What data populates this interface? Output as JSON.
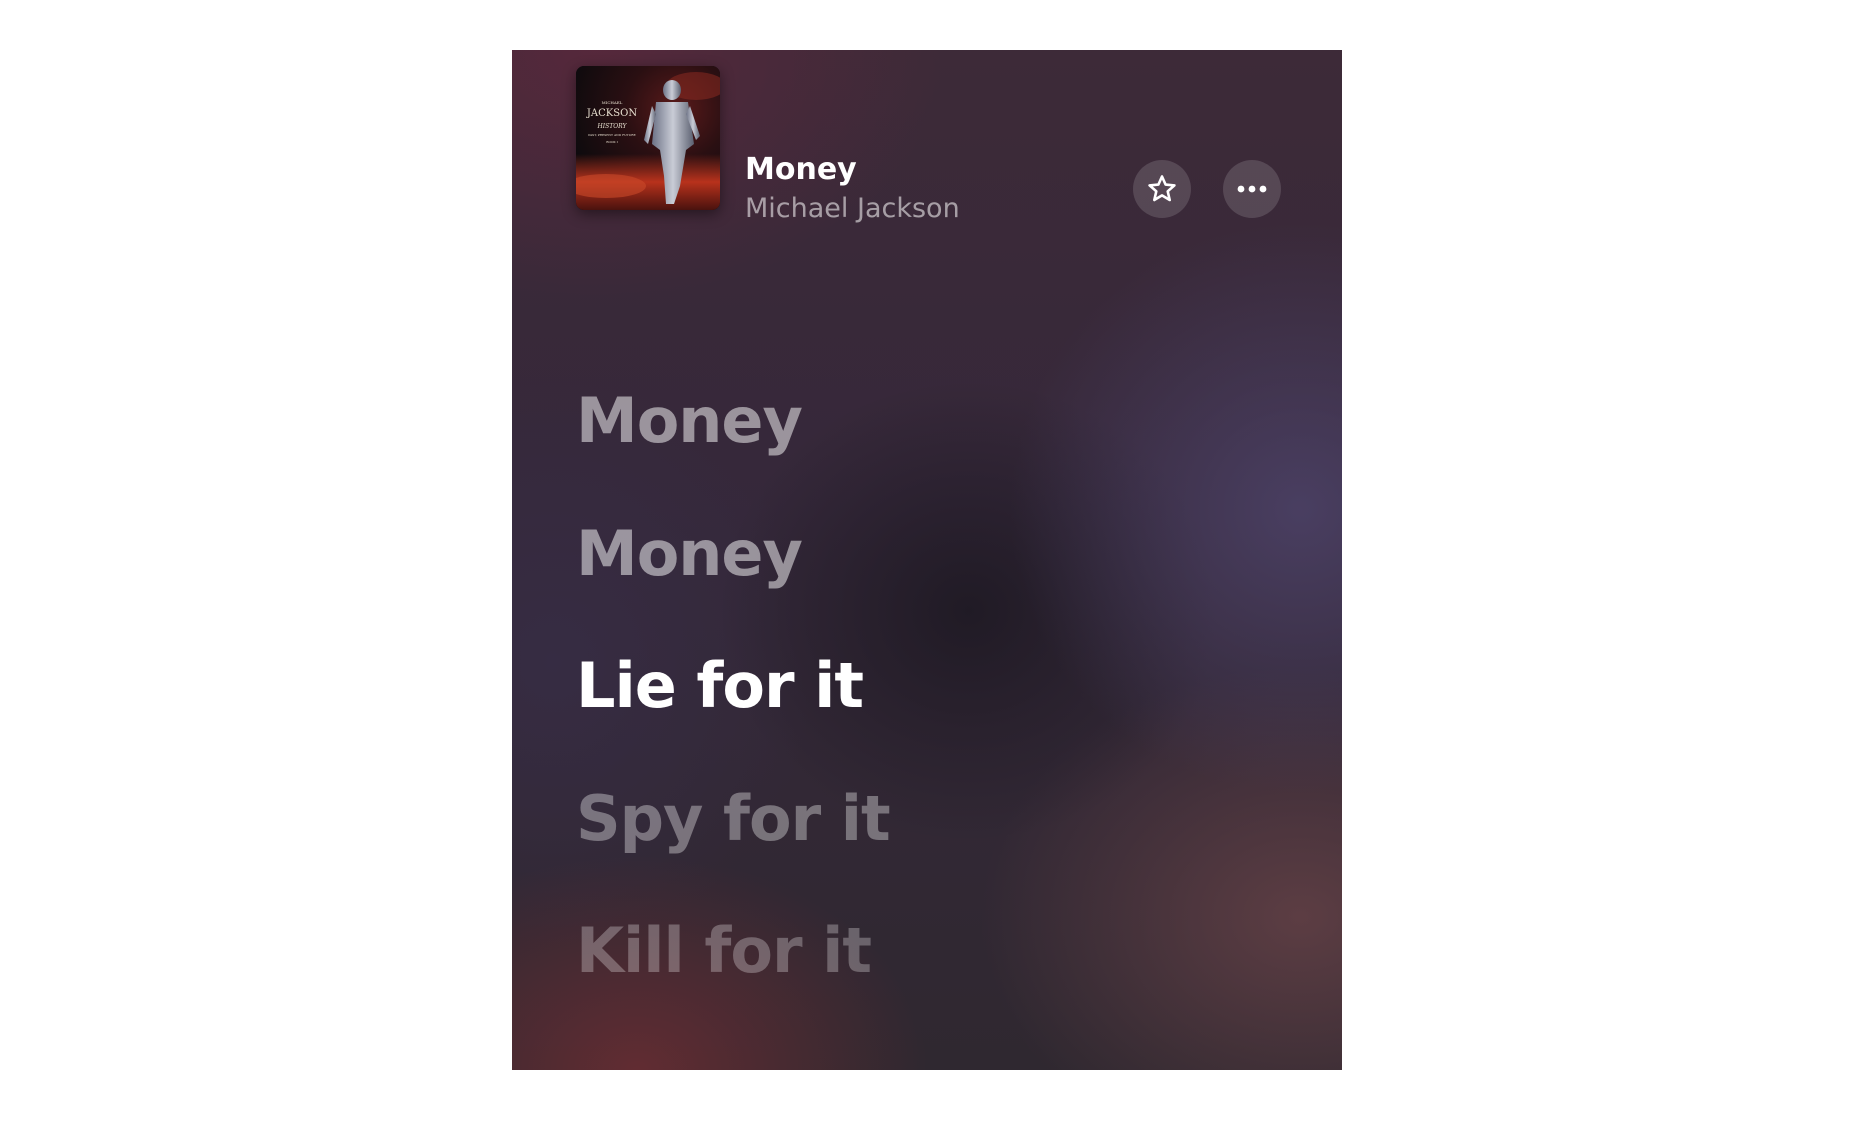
{
  "now_playing": {
    "title": "Money",
    "artist": "Michael Jackson",
    "album_art": {
      "icon": "album-cover-image",
      "text_lines": [
        "MICHAEL",
        "JACKSON",
        "HISTORY",
        "PAST, PRESENT AND FUTURE",
        "BOOK I"
      ]
    }
  },
  "actions": {
    "favorite_icon": "star-outline-icon",
    "more_icon": "ellipsis-icon"
  },
  "lyrics": {
    "lines": [
      {
        "text": "Money",
        "state": "past"
      },
      {
        "text": "Money",
        "state": "past"
      },
      {
        "text": "Lie for it",
        "state": "current"
      },
      {
        "text": "Spy for it",
        "state": "next"
      },
      {
        "text": "Kill for it",
        "state": "next"
      }
    ]
  },
  "colors": {
    "background": "#3a2a36",
    "active_lyric": "#ffffff"
  }
}
